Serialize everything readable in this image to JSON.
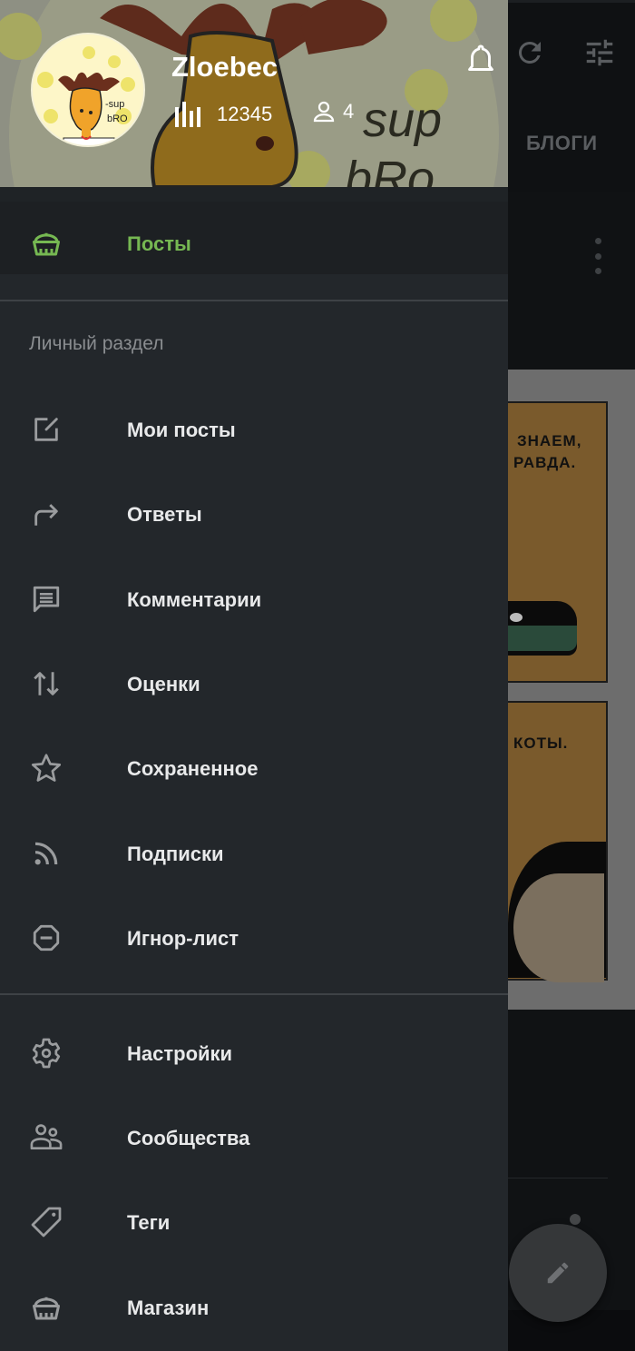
{
  "background_app": {
    "tab_label": "БЛОГИ",
    "toolbar_icons": [
      "refresh-icon",
      "tune-icon"
    ],
    "comic_text": [
      "ЗНАЕМ,",
      "РАВДА.",
      "КОТЫ."
    ],
    "fab_icon": "pencil-icon"
  },
  "drawer": {
    "header": {
      "username": "Zloebec",
      "rating": "12345",
      "subscribers": "4",
      "avatar_text": [
        "-sup",
        "bRO"
      ],
      "notifications_icon": "bell-icon"
    },
    "active_item": {
      "label": "Посты",
      "icon": "basket-icon",
      "color": "#76b852"
    },
    "section_label": "Личный раздел",
    "personal_items": [
      {
        "label": "Мои посты",
        "icon": "edit-square-icon"
      },
      {
        "label": "Ответы",
        "icon": "reply-arrow-icon"
      },
      {
        "label": "Комментарии",
        "icon": "comment-icon"
      },
      {
        "label": "Оценки",
        "icon": "swap-vertical-icon"
      },
      {
        "label": "Сохраненное",
        "icon": "star-icon"
      },
      {
        "label": "Подписки",
        "icon": "rss-icon"
      },
      {
        "label": "Игнор-лист",
        "icon": "block-icon"
      }
    ],
    "other_items": [
      {
        "label": "Настройки",
        "icon": "gear-icon"
      },
      {
        "label": "Сообщества",
        "icon": "group-icon"
      },
      {
        "label": "Теги",
        "icon": "tag-icon"
      },
      {
        "label": "Магазин",
        "icon": "shop-icon"
      }
    ]
  }
}
